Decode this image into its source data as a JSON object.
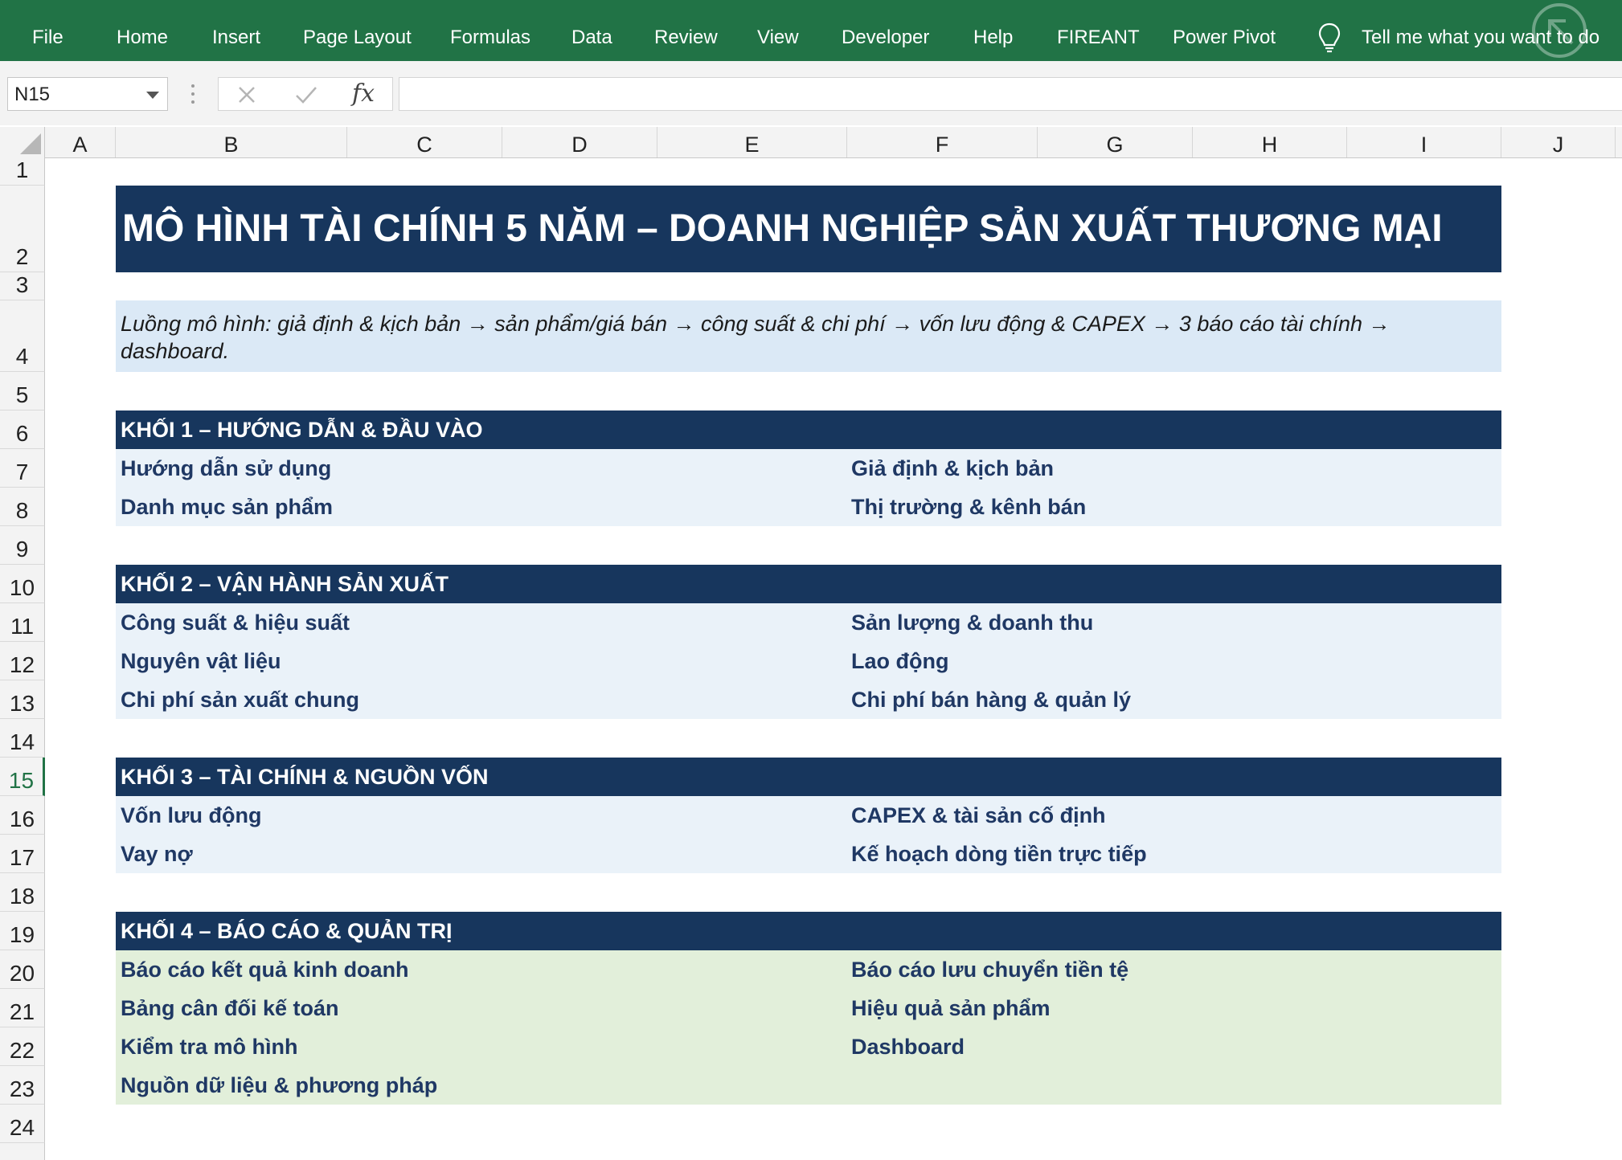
{
  "ribbon": {
    "tabs": [
      "File",
      "Home",
      "Insert",
      "Page Layout",
      "Formulas",
      "Data",
      "Review",
      "View",
      "Developer",
      "Help",
      "FIREANT",
      "Power Pivot"
    ],
    "tell_me": "Tell me what you want to do",
    "color": "#217346"
  },
  "formula_bar": {
    "name_box": "N15",
    "fx_label": "fx",
    "formula": ""
  },
  "columns": [
    "A",
    "B",
    "C",
    "D",
    "E",
    "F",
    "G",
    "H",
    "I",
    "J"
  ],
  "rows": [
    "1",
    "2",
    "3",
    "4",
    "5",
    "6",
    "7",
    "8",
    "9",
    "10",
    "11",
    "12",
    "13",
    "14",
    "15",
    "16",
    "17",
    "18",
    "19",
    "20",
    "21",
    "22",
    "23",
    "24"
  ],
  "active_row": "15",
  "sheet": {
    "title": "MÔ HÌNH TÀI CHÍNH 5 NĂM – DOANH NGHIỆP SẢN XUẤT THƯƠNG MẠI",
    "flow": "Luồng mô hình: giả định & kịch bản → sản phẩm/giá bán → công suất & chi phí → vốn lưu động & CAPEX → 3 báo cáo tài chính → dashboard.",
    "sections": [
      {
        "title": "KHỐI 1 – HƯỚNG DẪN & ĐẦU VÀO",
        "left": [
          "Hướng dẫn sử dụng",
          "Danh mục sản phẩm"
        ],
        "right": [
          "Giả định & kịch bản",
          "Thị trường & kênh bán"
        ]
      },
      {
        "title": "KHỐI 2 – VẬN HÀNH SẢN XUẤT",
        "left": [
          "Công suất & hiệu suất",
          "Nguyên vật liệu",
          "Chi phí sản xuất chung"
        ],
        "right": [
          "Sản lượng & doanh thu",
          "Lao động",
          "Chi phí bán hàng & quản lý"
        ]
      },
      {
        "title": "KHỐI 3 – TÀI CHÍNH & NGUỒN VỐN",
        "left": [
          "Vốn lưu động",
          "Vay nợ"
        ],
        "right": [
          "CAPEX & tài sản cố định",
          "Kế hoạch dòng tiền trực tiếp"
        ]
      },
      {
        "title": "KHỐI 4 – BÁO CÁO & QUẢN TRỊ",
        "left": [
          "Báo cáo kết quả kinh doanh",
          "Bảng cân đối kế toán",
          "Kiểm tra mô hình",
          "Nguồn dữ liệu & phương pháp"
        ],
        "right": [
          "Báo cáo lưu chuyển tiền tệ",
          "Hiệu quả sản phẩm",
          "Dashboard"
        ]
      }
    ]
  },
  "colors": {
    "header_navy": "#17365d",
    "band_blue": "#eaf2f9",
    "flow_blue": "#dbe9f6",
    "band_green": "#e2efda",
    "link_text": "#1f3864"
  }
}
